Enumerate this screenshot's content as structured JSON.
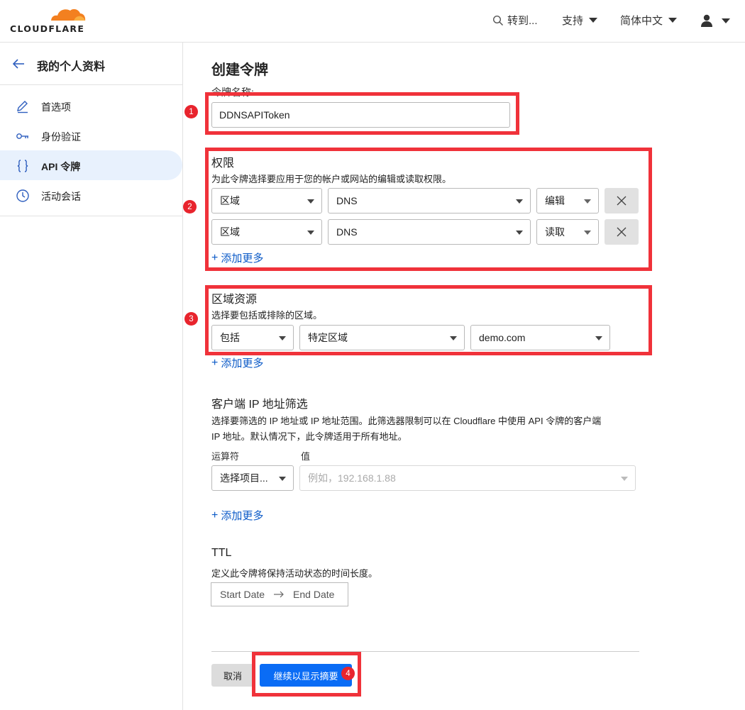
{
  "header": {
    "logo_text": "CLOUDFLARE",
    "goto_label": "转到...",
    "support_label": "支持",
    "language_label": "简体中文",
    "colors": {
      "logo_orange": "#f38020",
      "logo_light": "#faae40"
    }
  },
  "sidebar": {
    "title": "我的个人资料",
    "items": [
      {
        "label": "首选项",
        "icon": "pencil-icon",
        "active": false
      },
      {
        "label": "身份验证",
        "icon": "key-icon",
        "active": false
      },
      {
        "label": "API 令牌",
        "icon": "braces-icon",
        "active": true
      },
      {
        "label": "活动会话",
        "icon": "clock-icon",
        "active": false
      }
    ]
  },
  "main": {
    "title": "创建令牌",
    "token_name_label": "令牌名称:",
    "token_name_value": "DDNSAPIToken",
    "permissions": {
      "title": "权限",
      "description": "为此令牌选择要应用于您的帐户或网站的编辑或读取权限。",
      "rows": [
        {
          "scope": "区域",
          "resource": "DNS",
          "access": "编辑"
        },
        {
          "scope": "区域",
          "resource": "DNS",
          "access": "读取"
        }
      ],
      "add_more": "添加更多"
    },
    "zone_resources": {
      "title": "区域资源",
      "description": "选择要包括或排除的区域。",
      "include": "包括",
      "type": "特定区域",
      "zone": "demo.com",
      "add_more": "添加更多"
    },
    "ip_filter": {
      "title": "客户端 IP 地址筛选",
      "description_line1": "选择要筛选的 IP 地址或 IP 地址范围。此筛选器限制可以在 Cloudflare 中使用 API 令牌的客户端",
      "description_line2": "IP 地址。默认情况下，此令牌适用于所有地址。",
      "operator_label": "运算符",
      "value_label": "值",
      "operator_placeholder": "选择项目...",
      "value_placeholder": "例如，192.168.1.88",
      "add_more": "添加更多"
    },
    "ttl": {
      "title": "TTL",
      "description": "定义此令牌将保持活动状态的时间长度。",
      "start_placeholder": "Start Date",
      "end_placeholder": "End Date"
    },
    "cancel_label": "取消",
    "continue_label": "继续以显示摘要"
  },
  "annotations": {
    "badges": [
      "1",
      "2",
      "3",
      "4"
    ],
    "highlight_color": "#f0323a"
  }
}
